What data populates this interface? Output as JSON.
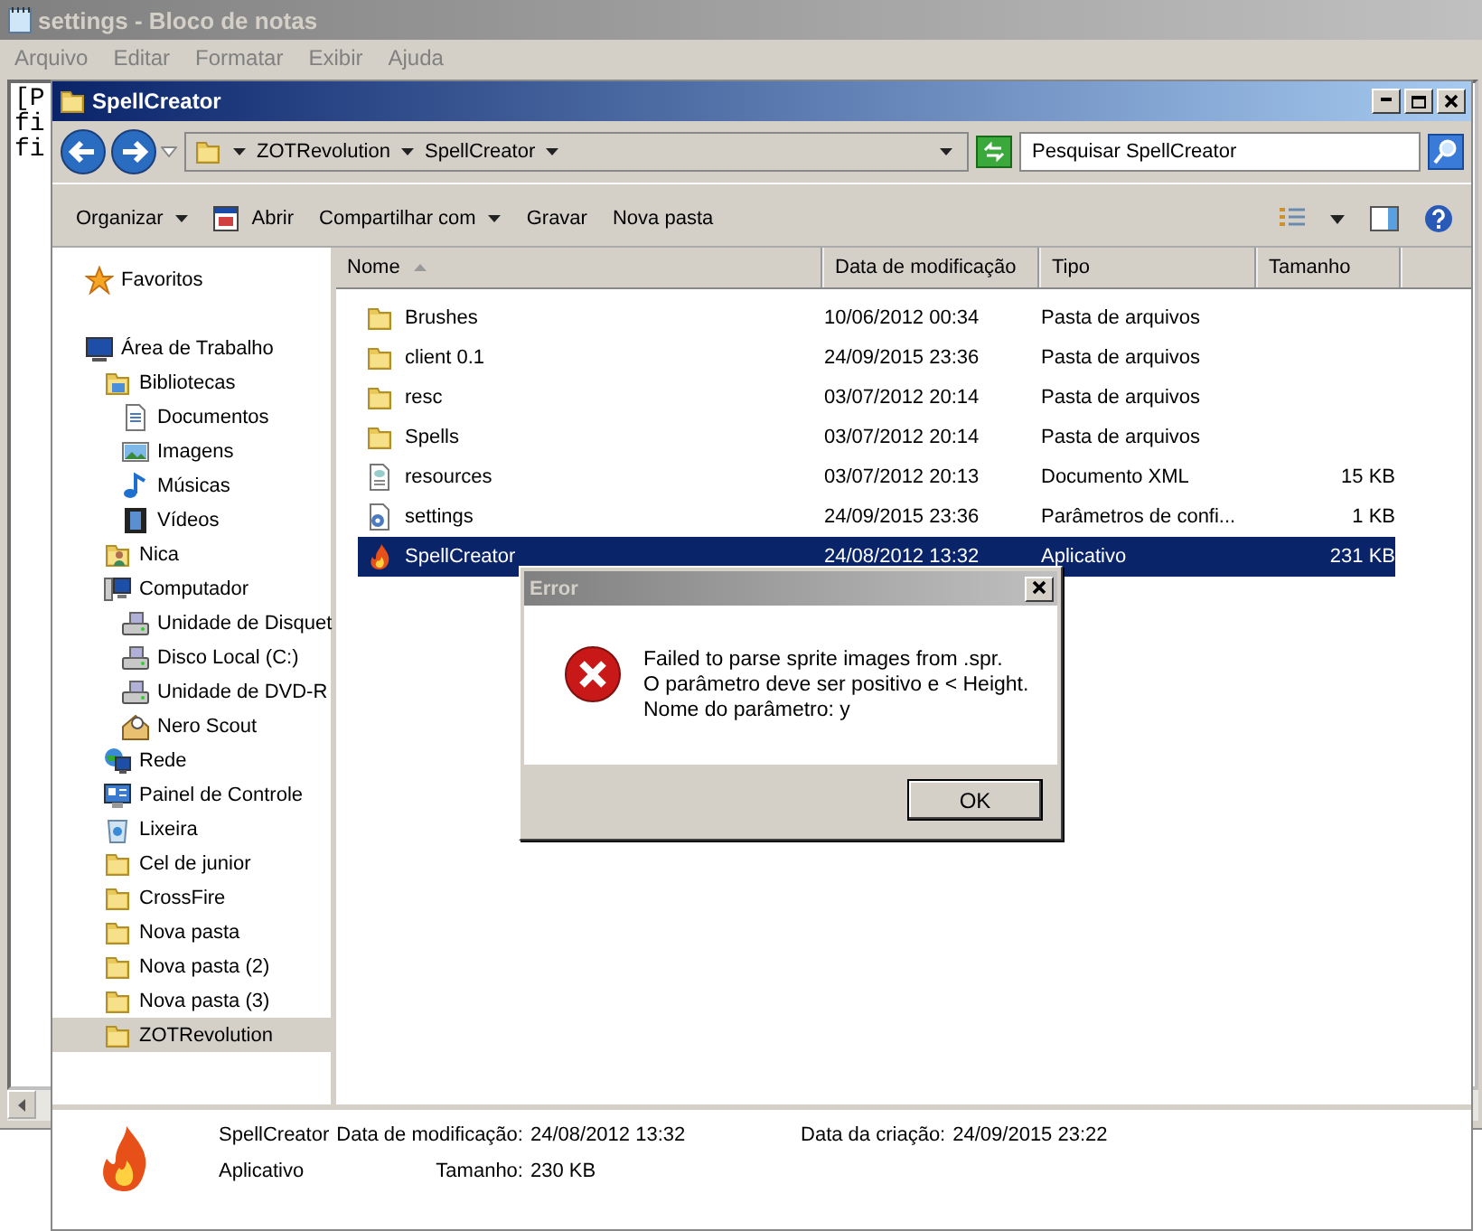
{
  "notepad": {
    "title": "settings - Bloco de notas",
    "menu": [
      "Arquivo",
      "Editar",
      "Formatar",
      "Exibir",
      "Ajuda"
    ],
    "lines": [
      "[P",
      "fi",
      "fi"
    ]
  },
  "explorer": {
    "title": "SpellCreator",
    "breadcrumb": [
      "ZOTRevolution",
      "SpellCreator"
    ],
    "search": {
      "placeholder": "Pesquisar SpellCreator"
    },
    "toolbar": [
      {
        "label": "Organizar",
        "kind": "menu"
      },
      {
        "label": "Abrir",
        "kind": "open"
      },
      {
        "label": "Compartilhar com",
        "kind": "menu"
      },
      {
        "label": "Gravar",
        "kind": "plain"
      },
      {
        "label": "Nova pasta",
        "kind": "plain"
      }
    ],
    "sidebar": {
      "favorites": {
        "label": "Favoritos",
        "kind": "star"
      },
      "tree": [
        {
          "label": "Área de Trabalho",
          "kind": "desktop",
          "selected": false,
          "children": [
            {
              "label": "Bibliotecas",
              "kind": "library",
              "selected": false,
              "children": [
                {
                  "label": "Documentos",
                  "kind": "document",
                  "selected": false
                },
                {
                  "label": "Imagens",
                  "kind": "image",
                  "selected": false
                },
                {
                  "label": "Músicas",
                  "kind": "music",
                  "selected": false
                },
                {
                  "label": "Vídeos",
                  "kind": "video",
                  "selected": false
                }
              ]
            },
            {
              "label": "Nica",
              "kind": "user",
              "selected": false
            },
            {
              "label": "Computador",
              "kind": "computer",
              "selected": false,
              "children": [
                {
                  "label": "Unidade de Disquet",
                  "kind": "drive",
                  "selected": false
                },
                {
                  "label": "Disco Local (C:)",
                  "kind": "drive",
                  "selected": false
                },
                {
                  "label": "Unidade de DVD-R",
                  "kind": "drive",
                  "selected": false
                },
                {
                  "label": "Nero Scout",
                  "kind": "scout",
                  "selected": false
                }
              ]
            },
            {
              "label": "Rede",
              "kind": "network",
              "selected": false
            },
            {
              "label": "Painel de Controle",
              "kind": "panel",
              "selected": false
            },
            {
              "label": "Lixeira",
              "kind": "trash",
              "selected": false
            },
            {
              "label": "Cel de junior",
              "kind": "folder",
              "selected": false
            },
            {
              "label": "CrossFire",
              "kind": "folder",
              "selected": false
            },
            {
              "label": "Nova pasta",
              "kind": "folder",
              "selected": false
            },
            {
              "label": "Nova pasta (2)",
              "kind": "folder",
              "selected": false
            },
            {
              "label": "Nova pasta (3)",
              "kind": "folder",
              "selected": false
            },
            {
              "label": "ZOTRevolution",
              "kind": "folder",
              "selected": true
            }
          ]
        }
      ]
    },
    "table": {
      "columns": [
        "Nome",
        "Data de modificação",
        "Tipo",
        "Tamanho"
      ],
      "rows": [
        {
          "name": "Brushes",
          "kind": "folder",
          "modified": "10/06/2012 00:34",
          "type": "Pasta de arquivos",
          "selected": false
        },
        {
          "name": "client 0.1",
          "kind": "folder",
          "modified": "24/09/2015 23:36",
          "type": "Pasta de arquivos",
          "selected": false
        },
        {
          "name": "resc",
          "kind": "folder",
          "modified": "03/07/2012 20:14",
          "type": "Pasta de arquivos",
          "selected": false
        },
        {
          "name": "Spells",
          "kind": "folder",
          "modified": "03/07/2012 20:14",
          "type": "Pasta de arquivos",
          "selected": false
        },
        {
          "name": "resources",
          "kind": "xml",
          "modified": "03/07/2012 20:13",
          "type": "Documento XML",
          "size": "15 KB",
          "selected": false
        },
        {
          "name": "settings",
          "kind": "config",
          "modified": "24/09/2015 23:36",
          "type": "Parâmetros de confi...",
          "size": "1 KB",
          "selected": false
        },
        {
          "name": "SpellCreator",
          "kind": "app",
          "modified": "24/08/2012 13:32",
          "type": "Aplicativo",
          "size": "231 KB",
          "selected": true
        }
      ]
    },
    "details": {
      "name": "SpellCreator",
      "type": "Aplicativo",
      "fields": [
        {
          "label": "Data de modificação:",
          "value": "24/08/2012 13:32"
        },
        {
          "label": "Tamanho:",
          "value": "230 KB"
        },
        {
          "label": "Data da criação:",
          "value": "24/09/2015 23:22"
        }
      ]
    }
  },
  "dialog": {
    "title": "Error",
    "message": "Failed to parse sprite images from .spr.\nO parâmetro deve ser positivo e < Height.\nNome do parâmetro: y",
    "buttons": [
      "OK"
    ]
  }
}
